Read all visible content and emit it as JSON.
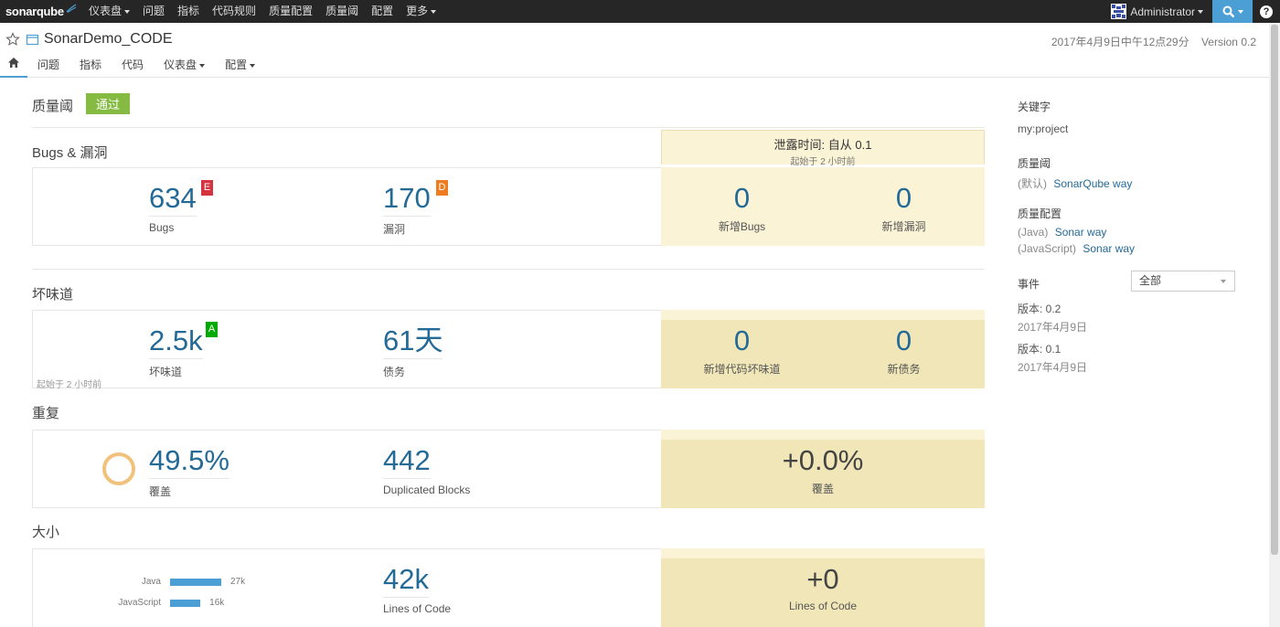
{
  "nav": {
    "logo_text": "sonarqube",
    "items": [
      {
        "label": "仪表盘",
        "dropdown": true
      },
      {
        "label": "问题",
        "dropdown": false
      },
      {
        "label": "指标",
        "dropdown": false
      },
      {
        "label": "代码规则",
        "dropdown": false
      },
      {
        "label": "质量配置",
        "dropdown": false
      },
      {
        "label": "质量阈",
        "dropdown": false
      },
      {
        "label": "配置",
        "dropdown": false
      },
      {
        "label": "更多",
        "dropdown": true
      }
    ],
    "user": "Administrator",
    "help_label": "?"
  },
  "project": {
    "name": "SonarDemo_CODE",
    "date": "2017年4月9日中午12点29分",
    "version": "Version 0.2",
    "tabs": [
      "问题",
      "指标",
      "代码",
      "仪表盘",
      "配置"
    ]
  },
  "quality_gate": {
    "title": "质量阈",
    "status": "通过"
  },
  "leak_period": {
    "title": "泄露时间: 自从 0.1",
    "subtitle": "起始于 2 小时前"
  },
  "sections": {
    "bugs": {
      "title": "Bugs & 漏洞",
      "bugs_value": "634",
      "bugs_label": "Bugs",
      "bugs_rating": "E",
      "vuln_value": "170",
      "vuln_label": "漏洞",
      "vuln_rating": "D",
      "new_bugs_value": "0",
      "new_bugs_label": "新增Bugs",
      "new_vuln_value": "0",
      "new_vuln_label": "新增漏洞"
    },
    "smells": {
      "title": "坏味道",
      "smell_value": "2.5k",
      "smell_label": "坏味道",
      "smell_rating": "A",
      "debt_value": "61天",
      "debt_label": "债务",
      "since_note": "起始于 2 小时前",
      "new_smell_value": "0",
      "new_smell_label": "新增代码坏味道",
      "new_debt_value": "0",
      "new_debt_label": "新债务"
    },
    "duplications": {
      "title": "重复",
      "dup_value": "49.5%",
      "dup_label": "覆盖",
      "dup_fraction": 0.495,
      "blocks_value": "442",
      "blocks_label": "Duplicated Blocks",
      "new_dup_value": "+0.0%",
      "new_dup_label": "覆盖"
    },
    "size": {
      "title": "大小",
      "languages": [
        {
          "name": "Java",
          "value": "27k",
          "amount": 27
        },
        {
          "name": "JavaScript",
          "value": "16k",
          "amount": 16
        }
      ],
      "loc_value": "42k",
      "loc_label": "Lines of Code",
      "new_loc_value": "+0",
      "new_loc_label": "Lines of Code"
    }
  },
  "sidebar": {
    "key_title": "关键字",
    "key_value": "my:project",
    "qg_title": "质量阈",
    "qg_prefix": "(默认)",
    "qg_link": "SonarQube way",
    "qp_title": "质量配置",
    "qp": [
      {
        "lang": "(Java)",
        "link": "Sonar way"
      },
      {
        "lang": "(JavaScript)",
        "link": "Sonar way"
      }
    ],
    "events_title": "事件",
    "events_filter": "全部",
    "events": [
      {
        "name": "版本: 0.2",
        "date": "2017年4月9日"
      },
      {
        "name": "版本: 0.1",
        "date": "2017年4月9日"
      }
    ]
  },
  "colors": {
    "accent": "#4b9fd5",
    "passed": "#85bb43",
    "rating_e": "#d4333f",
    "rating_d": "#ed7d20",
    "rating_a": "#00aa00",
    "leak": "#fbf3d5"
  }
}
